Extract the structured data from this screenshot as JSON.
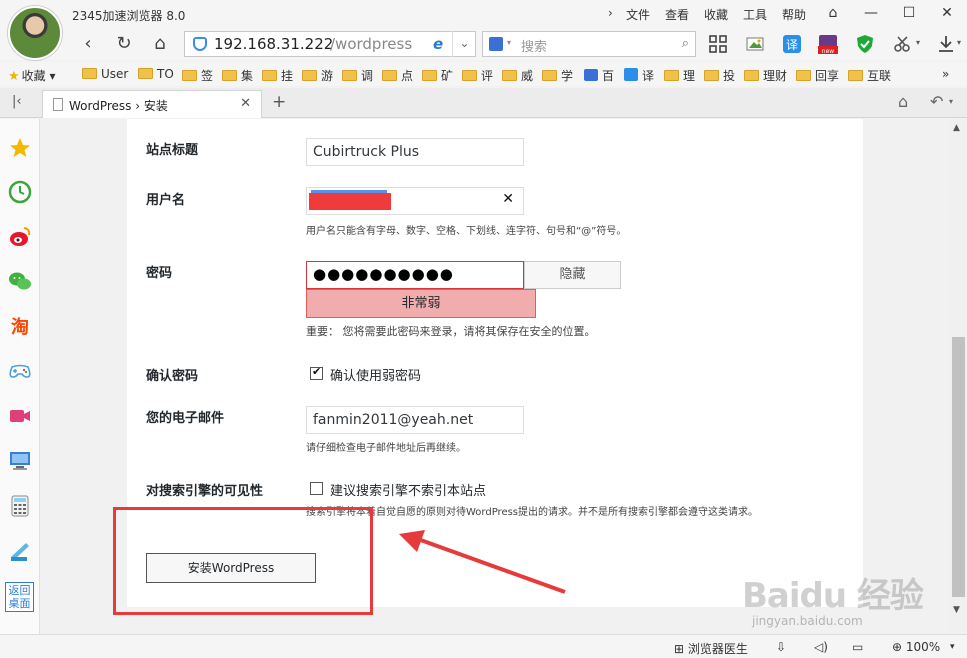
{
  "browser": {
    "title": "2345加速浏览器 8.0",
    "menu": [
      "文件",
      "查看",
      "收藏",
      "工具",
      "帮助"
    ],
    "address": {
      "host": "192.168.31.222",
      "path": "/wordpress"
    },
    "search_placeholder": "搜索"
  },
  "bookmarks": [
    "收藏",
    "User",
    "TO",
    "签",
    "集",
    "挂",
    "游",
    "调",
    "点",
    "矿",
    "评",
    "威",
    "学",
    "百",
    "译",
    "理",
    "投",
    "理财",
    "回享",
    "互联"
  ],
  "tab": {
    "title": "WordPress › 安装"
  },
  "sidebar": {
    "desktop_label_1": "返回",
    "desktop_label_2": "桌面"
  },
  "form": {
    "site_title_label": "站点标题",
    "site_title_value": "Cubirtruck Plus",
    "username_label": "用户名",
    "username_hint": "用户名只能含有字母、数字、空格、下划线、连字符、句号和“@”符号。",
    "password_label": "密码",
    "password_value": "●●●●●●●●●●",
    "hide_button": "隐藏",
    "strength": "非常弱",
    "password_hint": "重要： 您将需要此密码来登录，请将其保存在安全的位置。",
    "confirm_label": "确认密码",
    "confirm_checkbox_label": "确认使用弱密码",
    "email_label": "您的电子邮件",
    "email_value": "fanmin2011@yeah.net",
    "email_hint": "请仔细检查电子邮件地址后再继续。",
    "visibility_label": "对搜索引擎的可见性",
    "visibility_checkbox_label": "建议搜索引擎不索引本站点",
    "visibility_hint": "搜索引擎将本着自觉自愿的原则对待WordPress提出的请求。并不是所有搜索引擎都会遵守这类请求。",
    "install_button": "安装WordPress"
  },
  "statusbar": {
    "doctor": "浏览器医生",
    "zoom": "100%"
  },
  "watermark": {
    "main": "Baidu 经验",
    "sub": "jingyan.baidu.com"
  },
  "colors": {
    "accent": "#3c8fe0",
    "error": "#d63638",
    "strength_bg": "#f1adad",
    "highlight": "#e53b3b"
  }
}
